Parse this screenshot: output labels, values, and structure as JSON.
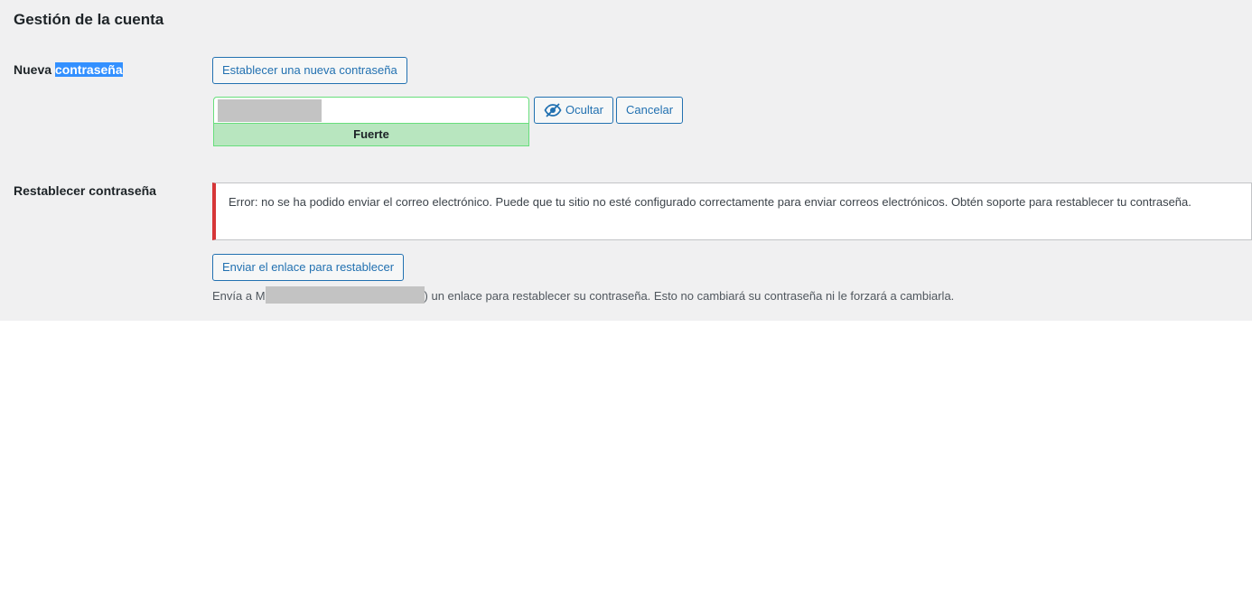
{
  "section": {
    "title": "Gestión de la cuenta"
  },
  "new_password": {
    "label_prefix": "Nueva ",
    "label_highlight": "contraseña",
    "set_button": "Establecer una nueva contraseña",
    "strength": "Fuerte",
    "hide_button": "Ocultar",
    "cancel_button": "Cancelar",
    "hide_icon": "eye-slash-icon"
  },
  "reset_password": {
    "label": "Restablecer contraseña",
    "error_message": "Error: no se ha podido enviar el correo electrónico. Puede que tu sitio no esté configurado correctamente para enviar correos electrónicos. Obtén soporte para restablecer tu contraseña.",
    "send_button": "Enviar el enlace para restablecer",
    "desc_prefix": "Envía a M",
    "desc_suffix": ") un enlace para restablecer su contraseña. Esto no cambiará su contraseña ni le forzará a cambiarla."
  },
  "colors": {
    "accent": "#2271b1",
    "error": "#d63638",
    "strong": "#b8e6bf",
    "panel": "#f0f0f1"
  }
}
